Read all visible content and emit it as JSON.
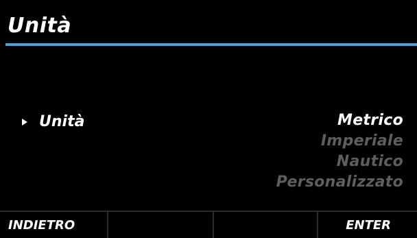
{
  "header": {
    "title": "Unità",
    "accent_color": "#4f9fd6"
  },
  "setting": {
    "pointer_icon": "triangle-right-icon",
    "label": "Unità",
    "options": [
      {
        "label": "Metrico",
        "selected": true
      },
      {
        "label": "Imperiale",
        "selected": false
      },
      {
        "label": "Nautico",
        "selected": false
      },
      {
        "label": "Personalizzato",
        "selected": false
      }
    ]
  },
  "softkeys": [
    {
      "label": "INDIETRO"
    },
    {
      "label": ""
    },
    {
      "label": ""
    },
    {
      "label": "ENTER"
    }
  ]
}
